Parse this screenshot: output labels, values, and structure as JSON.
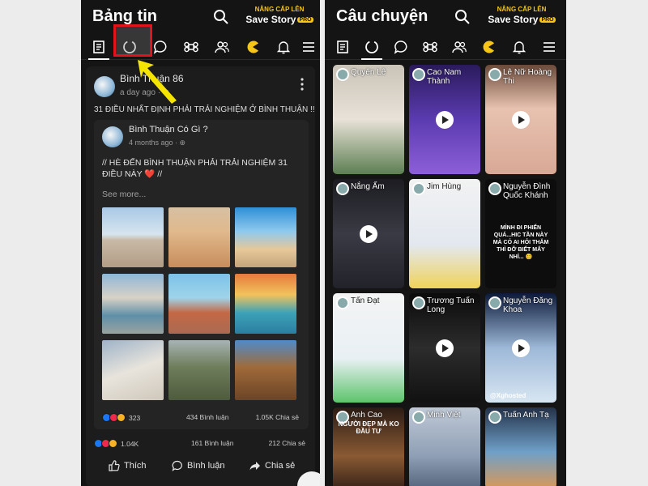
{
  "left": {
    "title": "Bảng tin",
    "promo": {
      "top": "NÂNG CẤP LÊN",
      "main": "Save Story",
      "badge": "PRO"
    },
    "post": {
      "author": "Bình Thuận 86",
      "meta": "a day ago",
      "text": "31 ĐIỀU NHẤT ĐỊNH PHẢI TRẢI NGHIỆM Ở BÌNH THUẬN !!",
      "shared": {
        "author": "Bình Thuận Có Gì ?",
        "meta": "4 months ago",
        "text": "// HÈ ĐẾN BÌNH THUẬN PHẢI TRẢI NGHIỆM 31 ĐIỀU NÀY ❤️ //",
        "see_more": "See more...",
        "stats": {
          "reactions": "323",
          "comments": "434 Bình luận",
          "shares": "1.05K Chia sẻ"
        }
      },
      "stats": {
        "reactions": "1.04K",
        "comments": "161 Bình luận",
        "shares": "212 Chia sẻ"
      },
      "actions": {
        "like": "Thích",
        "comment": "Bình luận",
        "share": "Chia sẻ"
      }
    }
  },
  "right": {
    "title": "Câu chuyện",
    "promo": {
      "top": "NÂNG CẤP LÊN",
      "main": "Save Story",
      "badge": "PRO"
    },
    "stories": [
      {
        "name": "Quyên Lê"
      },
      {
        "name": "Cao Nam Thành"
      },
      {
        "name": "Lê Nữ Hoàng Thi"
      },
      {
        "name": "Nắng Ấm"
      },
      {
        "name": "Jim Hùng"
      },
      {
        "name": "Nguyễn Đình Quốc Khánh",
        "caption": "MÌNH ĐI PHIẾN QUÁ...HIC TẦN NÀY MÀ CÓ AI HỎI THĂM THÌ ĐỠ BIẾT MẤY NHỈ... 😊"
      },
      {
        "name": "Tấn Đạt"
      },
      {
        "name": "Trương Tuấn Long"
      },
      {
        "name": "Nguyễn Đăng Khoa",
        "caption": "@Xghosted"
      },
      {
        "name": "Anh Cao",
        "caption": "NGƯỜI ĐẸP MÀ KO ĐẦU TƯ"
      },
      {
        "name": "Minh Việt"
      },
      {
        "name": "Tuấn Anh Tạ"
      }
    ]
  },
  "colors": {
    "highlight": "#e0141a",
    "arrow": "#f5e400",
    "promo": "#f5c518"
  }
}
